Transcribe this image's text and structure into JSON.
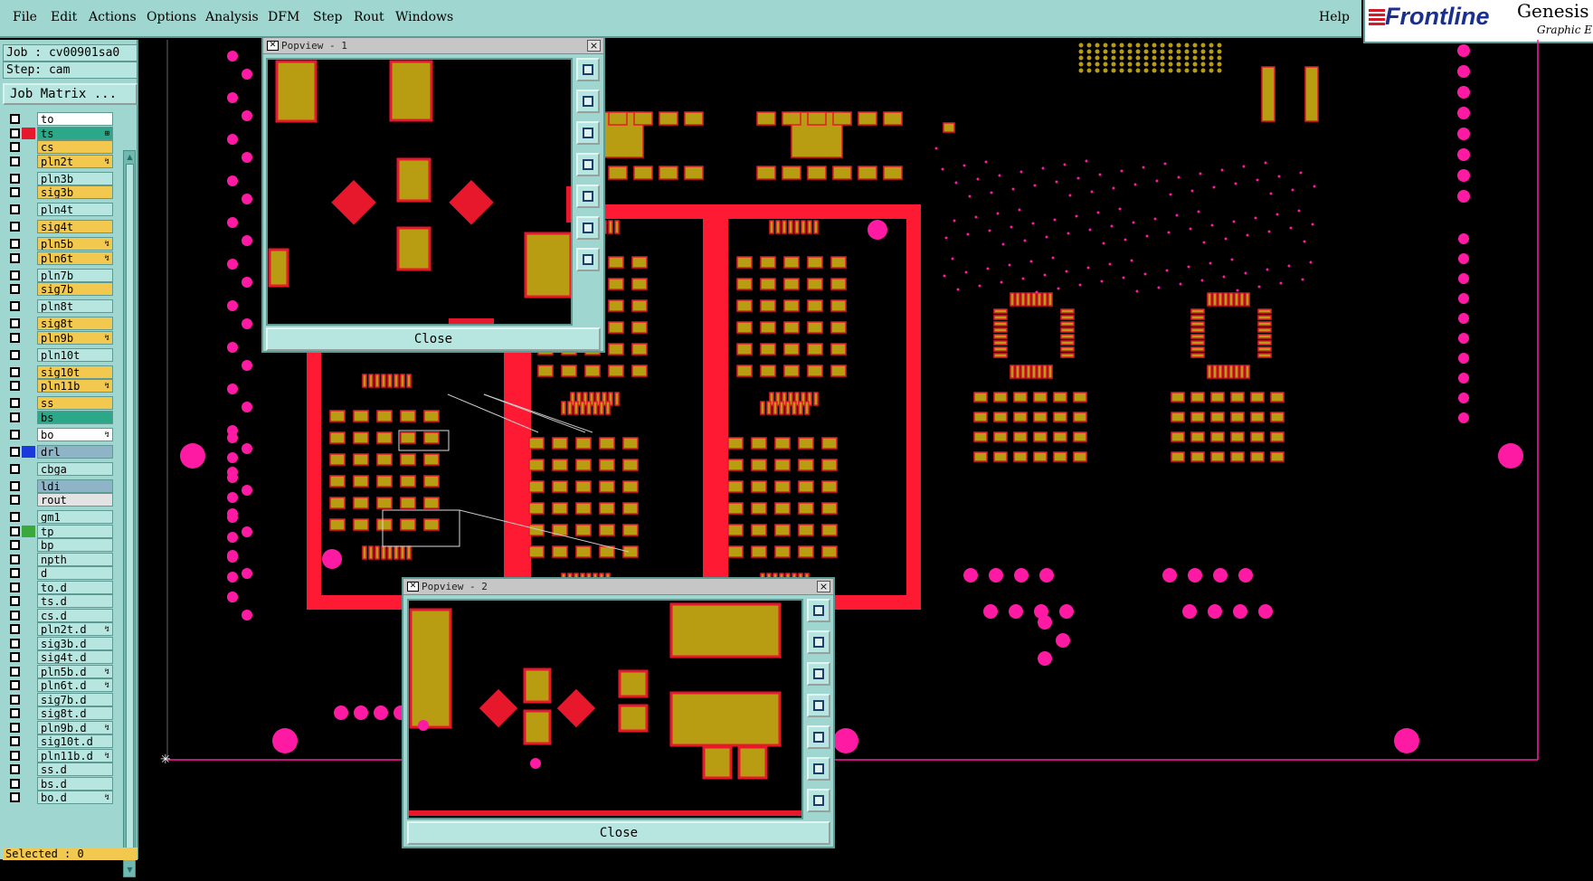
{
  "menu": {
    "items": [
      "File",
      "Edit",
      "Actions",
      "Options",
      "Analysis",
      "DFM",
      "Step",
      "Rout",
      "Windows"
    ],
    "help": "Help"
  },
  "brand": {
    "name": "Frontline",
    "product": "Genesis",
    "subtitle": "Graphic E"
  },
  "job": {
    "label": "Job : cv00901sa0",
    "step": "Step: cam",
    "matrix_button": "Job Matrix ..."
  },
  "layers": [
    {
      "name": "to",
      "color": "#ffffff",
      "swatch": ""
    },
    {
      "name": "ts",
      "color": "#2aa888",
      "swatch": "#e8182c",
      "mark": "⊞"
    },
    {
      "name": "cs",
      "color": "#f2c94e",
      "swatch": ""
    },
    {
      "name": "pln2t",
      "color": "#f2c94e",
      "swatch": "",
      "mark": "↯"
    },
    {
      "name": "pln3b",
      "color": "#b7e5df",
      "swatch": ""
    },
    {
      "name": "sig3b",
      "color": "#f2c94e",
      "swatch": ""
    },
    {
      "name": "pln4t",
      "color": "#b7e5df",
      "swatch": ""
    },
    {
      "name": "sig4t",
      "color": "#f2c94e",
      "swatch": ""
    },
    {
      "name": "pln5b",
      "color": "#f2c94e",
      "swatch": "",
      "mark": "↯"
    },
    {
      "name": "pln6t",
      "color": "#f2c94e",
      "swatch": "",
      "mark": "↯"
    },
    {
      "name": "pln7b",
      "color": "#b7e5df",
      "swatch": ""
    },
    {
      "name": "sig7b",
      "color": "#f2c94e",
      "swatch": ""
    },
    {
      "name": "pln8t",
      "color": "#b7e5df",
      "swatch": ""
    },
    {
      "name": "sig8t",
      "color": "#f2c94e",
      "swatch": ""
    },
    {
      "name": "pln9b",
      "color": "#f2c94e",
      "swatch": "",
      "mark": "↯"
    },
    {
      "name": "pln10t",
      "color": "#b7e5df",
      "swatch": ""
    },
    {
      "name": "sig10t",
      "color": "#f2c94e",
      "swatch": ""
    },
    {
      "name": "pln11b",
      "color": "#f2c94e",
      "swatch": "",
      "mark": "↯"
    },
    {
      "name": "ss",
      "color": "#f2c94e",
      "swatch": ""
    },
    {
      "name": "bs",
      "color": "#2aa888",
      "swatch": ""
    },
    {
      "name": "bo",
      "color": "#ffffff",
      "swatch": "",
      "mark": "↯"
    },
    {
      "name": "drl",
      "color": "#8fb4c8",
      "swatch": "#1a3adb"
    },
    {
      "name": "cbga",
      "color": "#b7e5df",
      "swatch": ""
    },
    {
      "name": "ldi",
      "color": "#8fb4c8",
      "swatch": ""
    },
    {
      "name": "rout",
      "color": "#e3e3e3",
      "swatch": ""
    },
    {
      "name": "gm1",
      "color": "#b7e5df",
      "swatch": ""
    },
    {
      "name": "tp",
      "color": "#b7e5df",
      "swatch": "#3aa83a"
    },
    {
      "name": "bp",
      "color": "#b7e5df",
      "swatch": ""
    },
    {
      "name": "npth",
      "color": "#b7e5df",
      "swatch": ""
    },
    {
      "name": "d",
      "color": "#b7e5df",
      "swatch": ""
    },
    {
      "name": "to.d",
      "color": "#b7e5df",
      "swatch": ""
    },
    {
      "name": "ts.d",
      "color": "#b7e5df",
      "swatch": ""
    },
    {
      "name": "cs.d",
      "color": "#b7e5df",
      "swatch": ""
    },
    {
      "name": "pln2t.d",
      "color": "#b7e5df",
      "swatch": "",
      "mark": "↯"
    },
    {
      "name": "sig3b.d",
      "color": "#b7e5df",
      "swatch": ""
    },
    {
      "name": "sig4t.d",
      "color": "#b7e5df",
      "swatch": ""
    },
    {
      "name": "pln5b.d",
      "color": "#b7e5df",
      "swatch": "",
      "mark": "↯"
    },
    {
      "name": "pln6t.d",
      "color": "#b7e5df",
      "swatch": "",
      "mark": "↯"
    },
    {
      "name": "sig7b.d",
      "color": "#b7e5df",
      "swatch": ""
    },
    {
      "name": "sig8t.d",
      "color": "#b7e5df",
      "swatch": ""
    },
    {
      "name": "pln9b.d",
      "color": "#b7e5df",
      "swatch": "",
      "mark": "↯"
    },
    {
      "name": "sig10t.d",
      "color": "#b7e5df",
      "swatch": ""
    },
    {
      "name": "pln11b.d",
      "color": "#b7e5df",
      "swatch": "",
      "mark": "↯"
    },
    {
      "name": "ss.d",
      "color": "#b7e5df",
      "swatch": ""
    },
    {
      "name": "bs.d",
      "color": "#b7e5df",
      "swatch": ""
    },
    {
      "name": "bo.d",
      "color": "#b7e5df",
      "swatch": "",
      "mark": "↯"
    }
  ],
  "status": {
    "selected": "Selected : 0"
  },
  "popview1": {
    "title": "Popview - 1",
    "close": "Close",
    "close_x": "×"
  },
  "popview2": {
    "title": "Popview - 2",
    "close": "Close",
    "close_x": "×"
  },
  "popview_tools": [
    "zoom-fit-icon",
    "zoom-in-icon",
    "zoom-out-icon",
    "pan-left-icon",
    "pan-right-icon",
    "zoom-home-icon",
    "zoom-area-icon"
  ],
  "colors": {
    "copper": "#b89c12",
    "outline": "#e8182c",
    "via": "#ff1aa3",
    "board": "#ff1a33",
    "panel": "#9fd7d0"
  }
}
